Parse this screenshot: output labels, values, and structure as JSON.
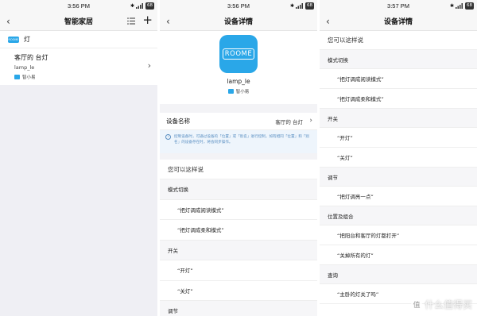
{
  "panel1": {
    "status": {
      "time": "3:56 PM",
      "battery": "68"
    },
    "title": "智能家居",
    "room": {
      "logo_text": "ROOME",
      "name": "灯"
    },
    "device": {
      "name": "客厅的 台灯",
      "id": "lamp_le",
      "source": "智小易"
    }
  },
  "panel2": {
    "status": {
      "time": "3:56 PM",
      "battery": "68"
    },
    "title": "设备详情",
    "logo_text": "ROOME",
    "device_id": "lamp_le",
    "source": "智小易",
    "device_name_label": "设备名称",
    "device_name_value": "客厅的 台灯",
    "notice": "控制设备时，可通过设备的「位置」或「别名」进行控制，如有相同「位置」和「别名」的设备存在时，将会同步操作。",
    "section_title": "您可以这样说",
    "cats": [
      "模式切换",
      "开关",
      "调节"
    ],
    "utterances": [
      "“把灯调成阅读模式”",
      "“把灯调成柔和模式”",
      "“开灯”",
      "“关灯”"
    ]
  },
  "panel3": {
    "status": {
      "time": "3:57 PM",
      "battery": "68"
    },
    "title": "设备详情",
    "section_title": "您可以这样说",
    "cats": [
      "模式切换",
      "开关",
      "调节",
      "位置及组合",
      "查询"
    ],
    "utterances": [
      "“把灯调成阅读模式”",
      "“把灯调成柔和模式”",
      "“开灯”",
      "“关灯”",
      "“把灯调亮一点”",
      "“把阳台和客厅的灯都打开”",
      "“关掉所有的灯”",
      "“主卧的灯关了吗”"
    ]
  },
  "watermark": {
    "badge": "值",
    "text": "什么值得买"
  },
  "colors": {
    "accent": "#2aa7e8",
    "notice_text": "#5a8fc2",
    "page_bg": "#efeff4"
  }
}
